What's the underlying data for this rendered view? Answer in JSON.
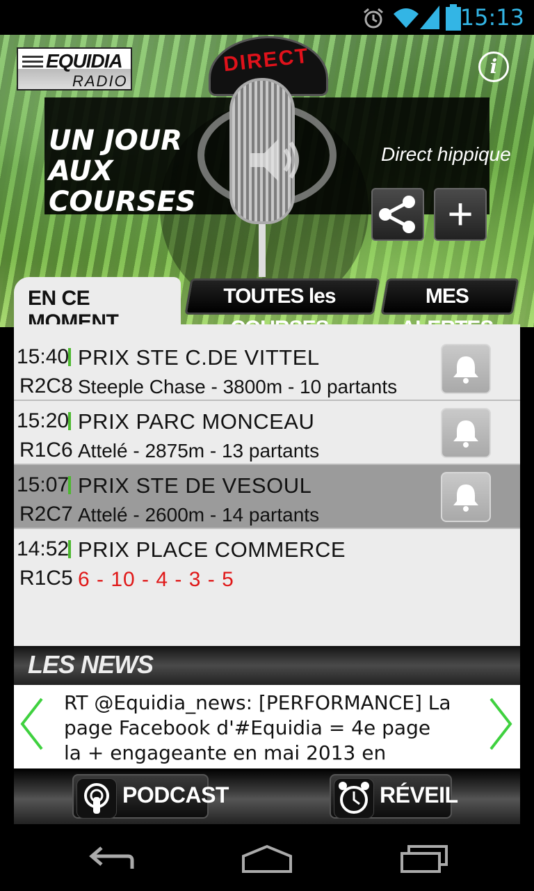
{
  "status_bar": {
    "time": "15:13"
  },
  "header": {
    "logo_line1": "EQUIDIA",
    "logo_line2": "RADIO",
    "info_label": "i",
    "direct_label": "DIRECT",
    "program_title": "UN JOUR AUX COURSES",
    "program_subtitle": "Direct hippique"
  },
  "tabs": [
    {
      "label": "EN CE MOMENT",
      "active": true
    },
    {
      "label": "TOUTES les COURSES",
      "active": false
    },
    {
      "label": "MES ALERTES",
      "active": false
    }
  ],
  "races": [
    {
      "time": "15:40",
      "code": "R2C8",
      "name": "PRIX STE C.DE VITTEL",
      "detail": "Steeple Chase - 3800m - 10 partants",
      "result": false,
      "selected": false,
      "alert": true
    },
    {
      "time": "15:20",
      "code": "R1C6",
      "name": "PRIX PARC MONCEAU",
      "detail": "Attelé - 2875m - 13 partants",
      "result": false,
      "selected": false,
      "alert": true
    },
    {
      "time": "15:07",
      "code": "R2C7",
      "name": "PRIX STE DE VESOUL",
      "detail": "Attelé - 2600m - 14 partants",
      "result": false,
      "selected": true,
      "alert": true
    },
    {
      "time": "14:52",
      "code": "R1C5",
      "name": "PRIX PLACE COMMERCE",
      "detail": "6 - 10 - 4 - 3 - 5",
      "result": true,
      "selected": false,
      "alert": false
    }
  ],
  "news": {
    "heading": "LES NEWS",
    "text": "RT @Equidia_news: [PERFORMANCE] La page Facebook d'#Equidia = 4e page la + engageante en mai 2013 en"
  },
  "footer": {
    "podcast_label": "PODCAST",
    "reveil_label": "RÉVEIL"
  },
  "colors": {
    "accent_green": "#4cb82f",
    "result_red": "#e01818",
    "status_blue": "#33b5e5"
  }
}
